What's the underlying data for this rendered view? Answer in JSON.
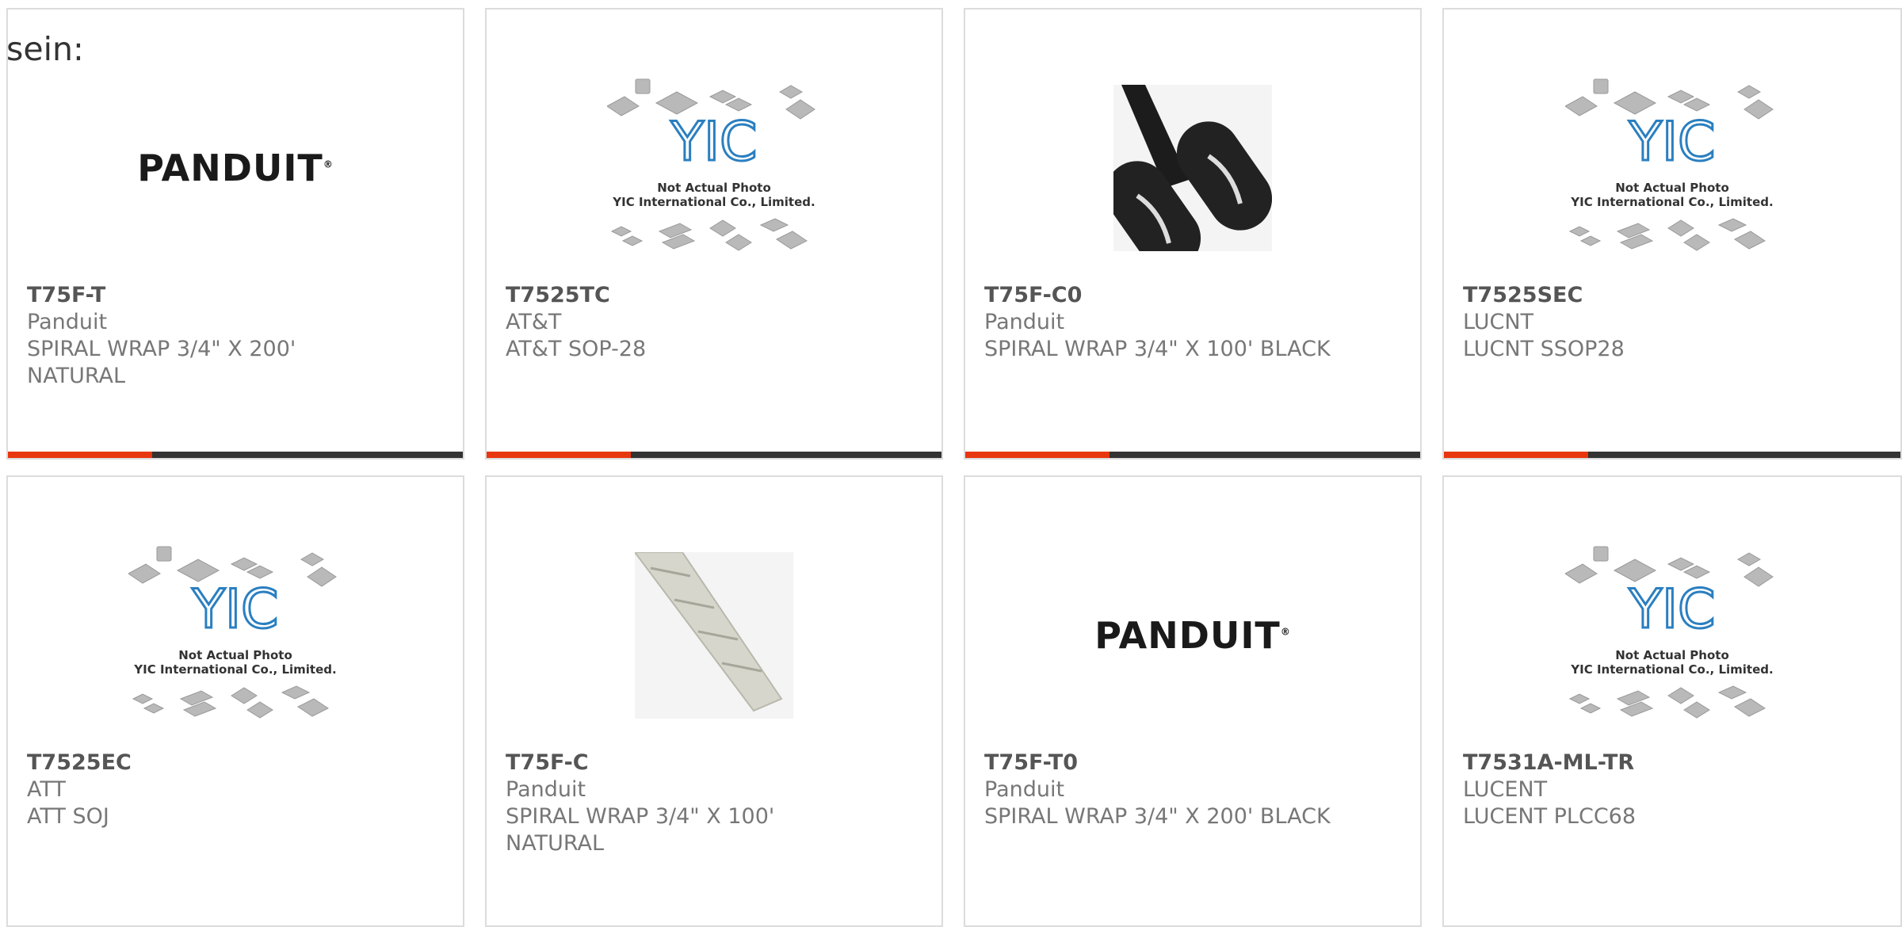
{
  "fragment_text": "sein:",
  "colors": {
    "accent": "#e8360e",
    "bar": "#333333",
    "border": "#dcdcdc"
  },
  "products": [
    {
      "part": "T75F-T",
      "manufacturer": "Panduit",
      "description": "SPIRAL WRAP 3/4\" X 200' NATURAL",
      "image": "panduit-logo",
      "logo_text": "PANDUIT"
    },
    {
      "part": "T7525TC",
      "manufacturer": "AT&T",
      "description": "AT&T SOP-28",
      "image": "yic-placeholder",
      "ph_line1": "Not Actual Photo",
      "ph_line2": "YIC International Co., Limited."
    },
    {
      "part": "T75F-C0",
      "manufacturer": "Panduit",
      "description": "SPIRAL WRAP 3/4\" X 100' BLACK",
      "image": "black-spiral-wrap"
    },
    {
      "part": "T7525SEC",
      "manufacturer": "LUCNT",
      "description": "LUCNT SSOP28",
      "image": "yic-placeholder",
      "ph_line1": "Not Actual Photo",
      "ph_line2": "YIC International Co., Limited."
    },
    {
      "part": "T7525EC",
      "manufacturer": "ATT",
      "description": "ATT SOJ",
      "image": "yic-placeholder",
      "ph_line1": "Not Actual Photo",
      "ph_line2": "YIC International Co., Limited."
    },
    {
      "part": "T75F-C",
      "manufacturer": "Panduit",
      "description": "SPIRAL WRAP 3/4\" X 100' NATURAL",
      "image": "natural-spiral-wrap"
    },
    {
      "part": "T75F-T0",
      "manufacturer": "Panduit",
      "description": "SPIRAL WRAP 3/4\" X 200' BLACK",
      "image": "panduit-logo",
      "logo_text": "PANDUIT"
    },
    {
      "part": "T7531A-ML-TR",
      "manufacturer": "LUCENT",
      "description": "LUCENT PLCC68",
      "image": "yic-placeholder",
      "ph_line1": "Not Actual Photo",
      "ph_line2": "YIC International Co., Limited."
    }
  ]
}
